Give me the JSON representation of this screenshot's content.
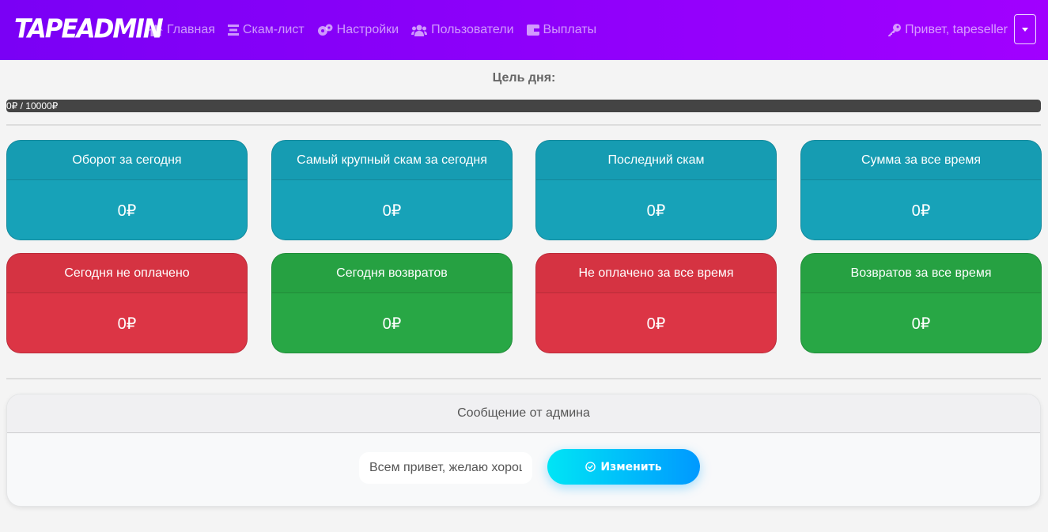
{
  "brand": {
    "name": "TAPEADMIN"
  },
  "nav": {
    "items": [
      {
        "label": "Главная",
        "icon": "home-icon"
      },
      {
        "label": "Скам-лист",
        "icon": "list-icon"
      },
      {
        "label": "Настройки",
        "icon": "cogs-icon"
      },
      {
        "label": "Пользователи",
        "icon": "users-icon"
      },
      {
        "label": "Выплаты",
        "icon": "wallet-icon"
      }
    ],
    "greeting": "Привет, tapeseller"
  },
  "goal": {
    "title": "Цель дня:",
    "progress_text": "0₽ / 10000₽",
    "current": 0,
    "target": 10000
  },
  "stats": [
    {
      "title": "Оборот за сегодня",
      "value": "0₽",
      "color": "#17a2b8"
    },
    {
      "title": "Самый крупный скам за сегодня",
      "value": "0₽",
      "color": "#17a2b8"
    },
    {
      "title": "Последний скам",
      "value": "0₽",
      "color": "#17a2b8"
    },
    {
      "title": "Сумма за все время",
      "value": "0₽",
      "color": "#17a2b8"
    },
    {
      "title": "Сегодня не оплачено",
      "value": "0₽",
      "color": "#dc3545"
    },
    {
      "title": "Сегодня возвратов",
      "value": "0₽",
      "color": "#28a745"
    },
    {
      "title": "Не оплачено за все время",
      "value": "0₽",
      "color": "#dc3545"
    },
    {
      "title": "Возвратов за все время",
      "value": "0₽",
      "color": "#28a745"
    }
  ],
  "admin_message": {
    "title": "Сообщение от админа",
    "input_value": "Всем привет, желаю хорошего дня",
    "button_label": "Изменить"
  }
}
